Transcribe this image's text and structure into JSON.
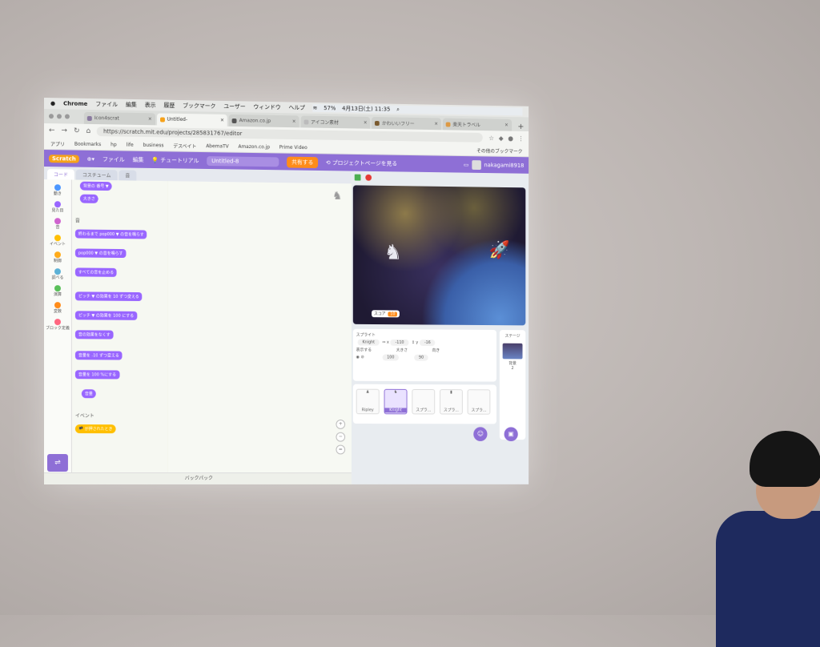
{
  "mac_menu": {
    "apple": "",
    "app": "Chrome",
    "items": [
      "ファイル",
      "編集",
      "表示",
      "履歴",
      "ブックマーク",
      "ユーザー",
      "ウィンドウ",
      "ヘルプ"
    ],
    "battery": "57%",
    "datetime": "4月13日(土) 11:35"
  },
  "browser": {
    "tabs": [
      {
        "label": "Icon4scrat"
      },
      {
        "label": "Untitled-"
      },
      {
        "label": "Amazon.co.jp"
      },
      {
        "label": "アイコン素材"
      },
      {
        "label": "かわいいフリー"
      },
      {
        "label": "楽天トラベル"
      }
    ],
    "url": "https://scratch.mit.edu/projects/285831767/editor",
    "bookmarks": [
      "アプリ",
      "Bookmarks",
      "hp",
      "life",
      "business",
      "デスベイト",
      "AbemaTV",
      "Amazon.co.jp",
      "Prime Video"
    ],
    "bookmarks_more": "その他のブックマーク"
  },
  "scratch_header": {
    "logo": "Scratch",
    "file": "ファイル",
    "edit": "編集",
    "tutorial": "チュートリアル",
    "project_title": "Untitled-8",
    "share": "共有する",
    "project_page": "プロジェクトページを見る",
    "username": "nakagami8918"
  },
  "editor_tabs": {
    "code": "コード",
    "costumes": "コスチューム",
    "sounds": "音"
  },
  "categories": [
    {
      "label": "動き",
      "color": "#4c97ff"
    },
    {
      "label": "見た目",
      "color": "#9966ff"
    },
    {
      "label": "音",
      "color": "#cf63cf"
    },
    {
      "label": "イベント",
      "color": "#ffbf00"
    },
    {
      "label": "制御",
      "color": "#ffab19"
    },
    {
      "label": "調べる",
      "color": "#5cb1d6"
    },
    {
      "label": "演算",
      "color": "#59c059"
    },
    {
      "label": "変数",
      "color": "#ff8c1a"
    },
    {
      "label": "ブロック定義",
      "color": "#ff6680"
    }
  ],
  "palette": {
    "blocks_top": [
      "背景の 番号 ▼",
      "大きさ"
    ],
    "sound_header": "音",
    "sound_blocks": [
      "終わるまで pop000 ▼ の音を鳴らす",
      "pop000 ▼ の音を鳴らす",
      "すべての音を止める",
      "ピッチ ▼ の効果を 10 ずつ変える",
      "ピッチ ▼ の効果を 100 にする",
      "音の効果をなくす",
      "音量を -10 ずつ変える",
      "音量を 100 %にする",
      "音量"
    ],
    "events_header": "イベント",
    "events_block": "が押されたとき"
  },
  "backpack": "バックパック",
  "stage": {
    "score_label": "スコア",
    "score_value": "10"
  },
  "sprite_info": {
    "sprite_label": "スプライト",
    "sprite_name": "Knight",
    "x": "-110",
    "y": "-16",
    "show_label": "表示する",
    "size_label": "大きさ",
    "size": "100",
    "direction_label": "向き",
    "direction": "90"
  },
  "stage_pane": {
    "title": "ステージ",
    "backdrops_label": "背景",
    "backdrops_count": "2"
  },
  "sprites": [
    "Ripley",
    "Knight",
    "スプラ...",
    "スプラ...",
    "スプラ..."
  ]
}
